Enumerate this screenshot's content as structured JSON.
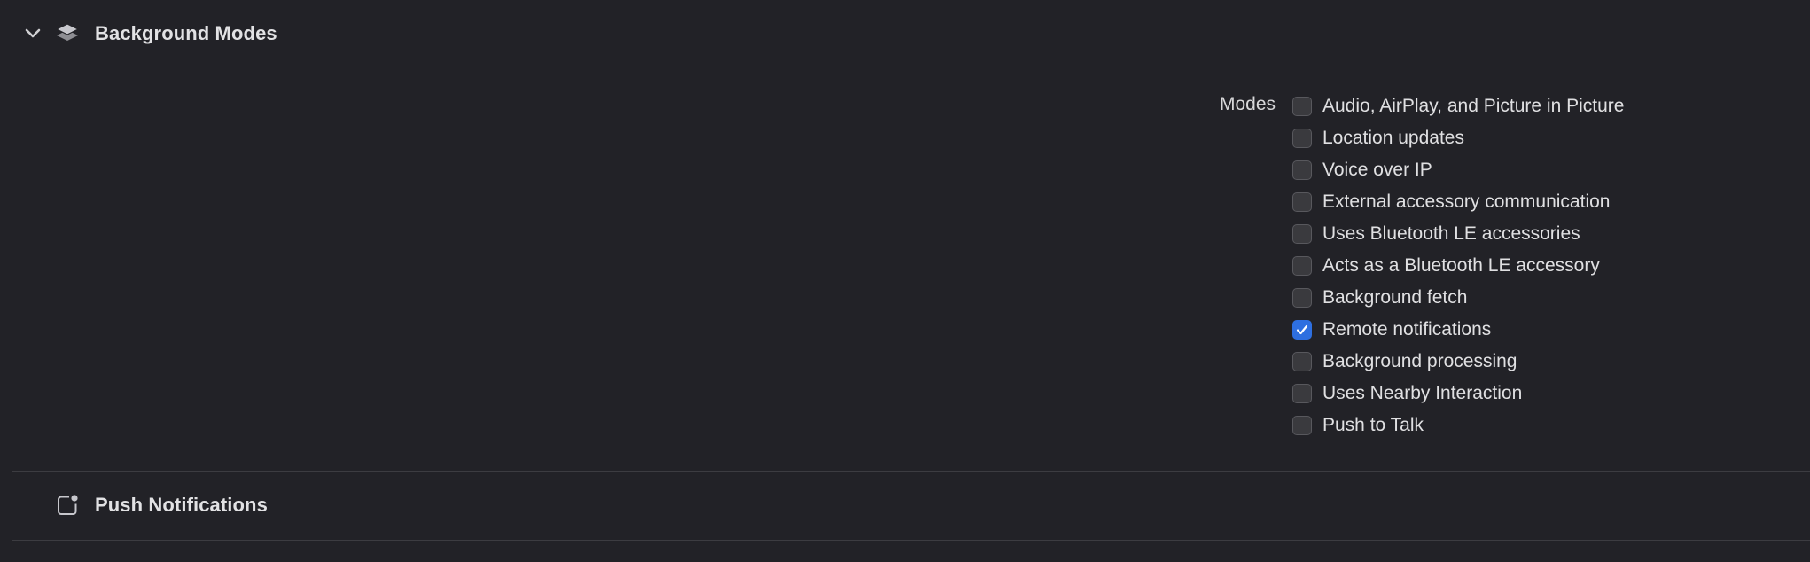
{
  "background_modes": {
    "title": "Background Modes",
    "expanded": true,
    "icons": {
      "disclosure": "chevron-down-icon",
      "section": "stacked-layers-icon"
    },
    "modes_label": "Modes",
    "modes": [
      {
        "label": "Audio, AirPlay, and Picture in Picture",
        "checked": false
      },
      {
        "label": "Location updates",
        "checked": false
      },
      {
        "label": "Voice over IP",
        "checked": false
      },
      {
        "label": "External accessory communication",
        "checked": false
      },
      {
        "label": "Uses Bluetooth LE accessories",
        "checked": false
      },
      {
        "label": "Acts as a Bluetooth LE accessory",
        "checked": false
      },
      {
        "label": "Background fetch",
        "checked": false
      },
      {
        "label": "Remote notifications",
        "checked": true
      },
      {
        "label": "Background processing",
        "checked": false
      },
      {
        "label": "Uses Nearby Interaction",
        "checked": false
      },
      {
        "label": "Push to Talk",
        "checked": false
      }
    ]
  },
  "push_notifications": {
    "title": "Push Notifications",
    "icon": "app-badge-icon"
  },
  "colors": {
    "background": "#222227",
    "checkbox_checked": "#2e6fe0",
    "checkbox_unchecked": "#3a3a3e",
    "divider": "#3c3c41"
  }
}
